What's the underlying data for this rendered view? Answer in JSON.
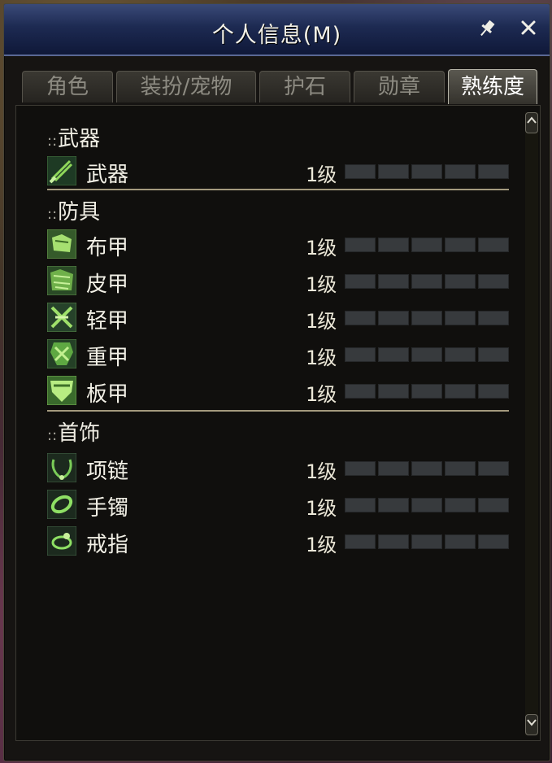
{
  "window": {
    "title": "个人信息(M)",
    "pin_glyph": "📌",
    "close_glyph": "✕"
  },
  "tabs": [
    {
      "label": "角色",
      "active": false
    },
    {
      "label": "装扮/宠物",
      "active": false
    },
    {
      "label": "护石",
      "active": false
    },
    {
      "label": "勋章",
      "active": false
    },
    {
      "label": "熟练度",
      "active": true
    }
  ],
  "sections": [
    {
      "prefix": "::",
      "title": "武器",
      "items": [
        {
          "name": "武器",
          "level": "1级",
          "icon": "weapon-icon",
          "progress": 0
        }
      ]
    },
    {
      "prefix": "::",
      "title": "防具",
      "items": [
        {
          "name": "布甲",
          "level": "1级",
          "icon": "cloth-armor-icon",
          "progress": 0
        },
        {
          "name": "皮甲",
          "level": "1级",
          "icon": "leather-armor-icon",
          "progress": 0
        },
        {
          "name": "轻甲",
          "level": "1级",
          "icon": "light-armor-icon",
          "progress": 0
        },
        {
          "name": "重甲",
          "level": "1级",
          "icon": "heavy-armor-icon",
          "progress": 0
        },
        {
          "name": "板甲",
          "level": "1级",
          "icon": "plate-armor-icon",
          "progress": 0
        }
      ]
    },
    {
      "prefix": "::",
      "title": "首饰",
      "items": [
        {
          "name": "项链",
          "level": "1级",
          "icon": "necklace-icon",
          "progress": 0
        },
        {
          "name": "手镯",
          "level": "1级",
          "icon": "bracelet-icon",
          "progress": 0
        },
        {
          "name": "戒指",
          "level": "1级",
          "icon": "ring-icon",
          "progress": 0
        }
      ]
    }
  ],
  "colors": {
    "title_bar": "#1d2a52",
    "icon_green": "#8fd85a",
    "bar_empty": "#373a3d"
  }
}
